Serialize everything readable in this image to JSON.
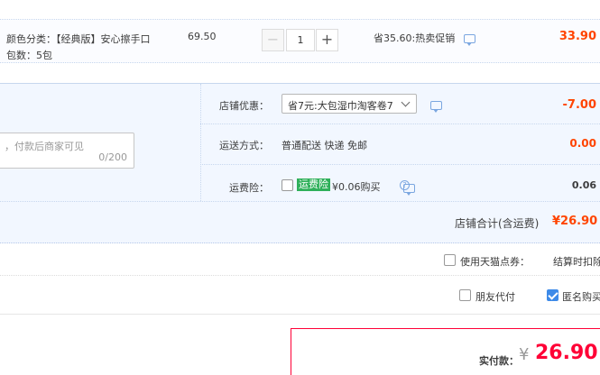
{
  "product": {
    "sku_text": "颜色分类：【经典版】安心擦手口",
    "pack_text": "包数：5包",
    "unit_price": "69.50",
    "quantity_minus": "−",
    "quantity": "1",
    "quantity_plus": "+",
    "savings_text": "省35.60:热卖促销",
    "line_total": "33.90"
  },
  "shop": {
    "memo_placeholder": "，付款后商家可见",
    "memo_count": "0/200",
    "coupon_label": "店铺优惠：",
    "coupon_value": "省7元:大包湿巾淘客卷7",
    "coupon_amount": "-7.00",
    "shipping_label": "运送方式：",
    "shipping_value": "普通配送 快递 免邮",
    "shipping_amount": "0.00",
    "insurance_label": "运费险：",
    "insurance_tag": "运费险",
    "insurance_price": "¥0.06购买",
    "insurance_help": "?",
    "insurance_amount": "0.06",
    "total_label": "店铺合计(含运费)",
    "total_amount": "¥26.90"
  },
  "options": {
    "tmall_points_label": "使用天猫点券：",
    "deduct_label": "结算时扣除",
    "friend_pay_label": "朋友代付",
    "anonymous_label": "匿名购买",
    "anonymous_checked": true
  },
  "payment": {
    "label": "实付款：",
    "currency": "¥",
    "amount": "26.90"
  },
  "colors": {
    "price_red": "#ff4400",
    "pay_red": "#ff0036",
    "panel_blue": "#f2f7ff",
    "checkbox_blue": "#3d8ae8",
    "insurance_green": "#2fb05a"
  }
}
